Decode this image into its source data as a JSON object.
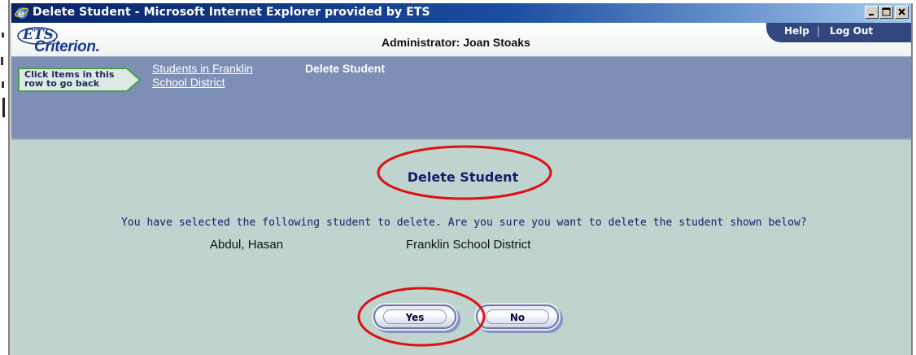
{
  "window": {
    "title": "Delete Student - Microsoft Internet Explorer provided by ETS",
    "controls": [
      "minimize",
      "maximize",
      "close"
    ]
  },
  "header": {
    "logo_ets": "ETS",
    "logo_product": "Criterion.",
    "administrator": "Administrator: Joan Stoaks",
    "links": {
      "help": "Help",
      "separator": "|",
      "logout": "Log Out"
    }
  },
  "breadcrumb": {
    "hint": "Click items in this\nrow to go back",
    "link": "Students in Franklin School District",
    "current": "Delete Student"
  },
  "main": {
    "title": "Delete Student",
    "question": "You have selected the following student to delete. Are you sure you want to delete the student shown below?",
    "student": {
      "name": "Abdul, Hasan",
      "school": "Franklin School District"
    },
    "buttons": {
      "yes": "Yes",
      "no": "No"
    }
  },
  "colors": {
    "titlebar": "#0a246a",
    "breadcrumb_bar": "#7e8fb5",
    "content_bg": "#bfd4cf",
    "annotation_circle": "#dd1111"
  },
  "icons": [
    "ie-icon",
    "minimize-icon",
    "maximize-icon",
    "close-icon",
    "arrow-right-icon"
  ]
}
